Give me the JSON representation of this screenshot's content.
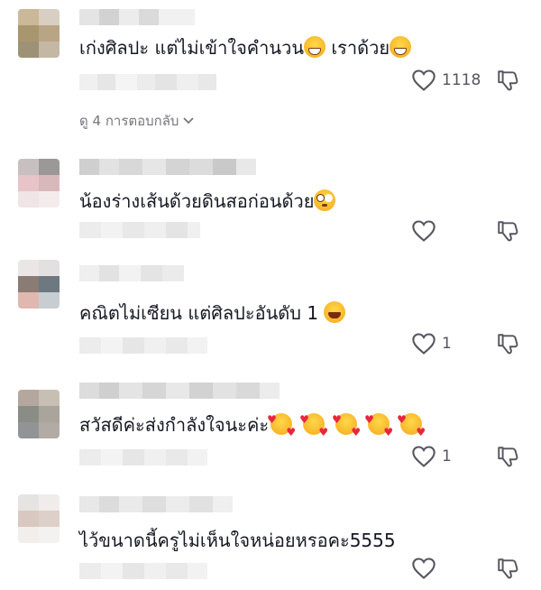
{
  "comments": [
    {
      "text": "เก่งศิลปะ แต่ไม่เข้าใจคำนวน",
      "emoji1": "grinning-squinting-face",
      "text2": " เราด้วย",
      "emoji2": "grinning-squinting-face",
      "likes": "1118"
    },
    {
      "text": "น้องร่างเส้นด้วยดินสอก่อนด้วย",
      "emoji1": "flushed-face",
      "likes": ""
    },
    {
      "text": "คณิตไม่เซียน แต่ศิลปะอันดับ 1 ",
      "emoji1": "face-with-tears-of-joy",
      "likes": "1"
    },
    {
      "text": "สวัสดีค่ะส่งกำลังใจนะค่ะ",
      "emoji1": "smiling-face-with-hearts",
      "emoji_count": 5,
      "likes": "1"
    },
    {
      "text": "ไว้ขนาดนี้ครูไม่เห็นใจหน่อยหรอคะ5555",
      "likes": ""
    }
  ],
  "replies": {
    "label": "ดู 4 การตอบกลับ"
  },
  "icons": {
    "like": "heart-outline-icon",
    "dislike": "thumbs-down-outline-icon",
    "expand": "chevron-down-icon"
  },
  "colors": {
    "text": "#161823",
    "muted": "#75767c",
    "icon": "#55565e"
  }
}
